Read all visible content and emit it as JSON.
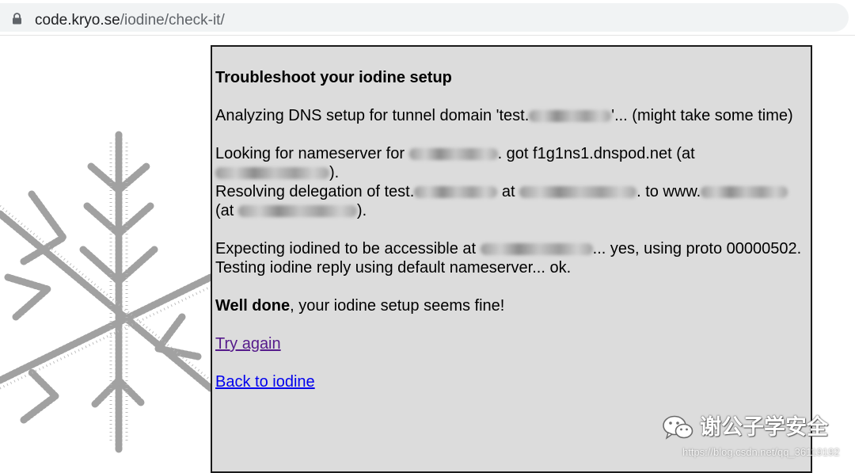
{
  "browser": {
    "url_host": "code.kryo.se",
    "url_path": "/iodine/check-it/",
    "lock_icon": "lock-icon"
  },
  "panel": {
    "heading": "Troubleshoot your iodine setup",
    "analyzing_pre": "Analyzing DNS setup for tunnel domain 'test.",
    "analyzing_post": "'... (might take some time)",
    "lookup_pre": "Looking for nameserver for ",
    "lookup_got": ". got f1g1ns1.dnspod.net (at",
    "lookup_close": ").",
    "resolving_pre": "Resolving delegation of test.",
    "resolving_at": " at ",
    "resolving_to": ". to www.",
    "resolving_at2": "(at ",
    "resolving_close": ").",
    "expect_pre": "Expecting iodined to be accessible at ",
    "expect_post": "... yes, using proto 00000502.",
    "testing": "Testing iodine reply using default nameserver... ok.",
    "done_bold": "Well done",
    "done_rest": ", your iodine setup seems fine!",
    "try_again": "Try again",
    "back": "Back to iodine"
  },
  "watermark": {
    "logo_icon": "wechat-icon",
    "name": "谢公子学安全",
    "url": "https://blog.csdn.net/qq_36119192"
  },
  "colors": {
    "panel_bg": "#dcdcdc",
    "visited_link": "#551a8b",
    "link": "#0000ee"
  }
}
